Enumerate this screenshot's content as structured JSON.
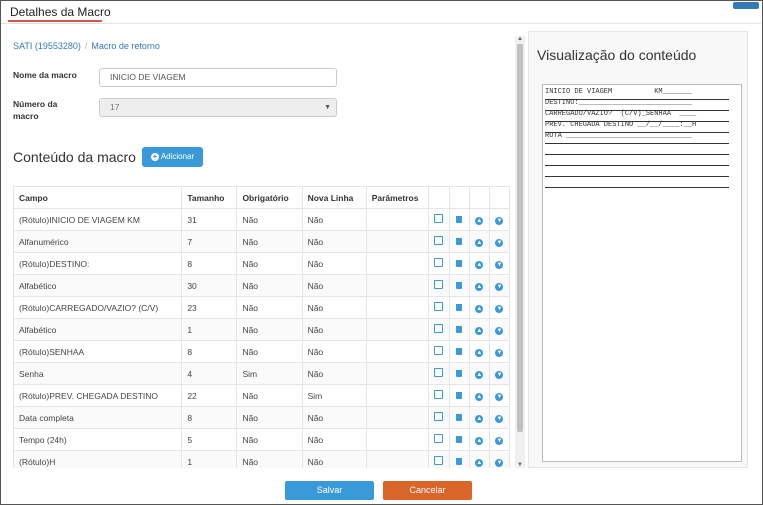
{
  "window": {
    "title": "Detalhes da Macro"
  },
  "breadcrumb": {
    "item1": "SATI (19553280)",
    "sep": "/",
    "item2": "Macro de retorno"
  },
  "form": {
    "nome_label": "Nome da macro",
    "nome_value": "INICIO DE VIAGEM",
    "numero_label_1": "Número da",
    "numero_label_2": "macro",
    "numero_value": "17"
  },
  "content": {
    "title": "Conteúdo da macro",
    "add_label": "Adicionar"
  },
  "table": {
    "headers": [
      "Campo",
      "Tamanho",
      "Obrigatório",
      "Nova Linha",
      "Parâmetros"
    ],
    "rows": [
      [
        "(Rótulo)INICIO DE VIAGEM KM",
        "31",
        "Não",
        "Não"
      ],
      [
        "Alfanumérico",
        "7",
        "Não",
        "Não"
      ],
      [
        "(Rótulo)DESTINO:",
        "8",
        "Não",
        "Não"
      ],
      [
        "Alfabético",
        "30",
        "Não",
        "Não"
      ],
      [
        "(Rótulo)CARREGADO/VAZIO? (C/V)",
        "23",
        "Não",
        "Não"
      ],
      [
        "Alfabético",
        "1",
        "Não",
        "Não"
      ],
      [
        "(Rótulo)SENHAA",
        "8",
        "Não",
        "Não"
      ],
      [
        "Senha",
        "4",
        "Sim",
        "Não"
      ],
      [
        "(Rótulo)PREV. CHEGADA DESTINO",
        "22",
        "Não",
        "Sim"
      ],
      [
        "Data completa",
        "8",
        "Não",
        "Não"
      ],
      [
        "Tempo (24h)",
        "5",
        "Não",
        "Não"
      ],
      [
        "(Rótulo)H",
        "1",
        "Não",
        "Não"
      ]
    ]
  },
  "preview": {
    "title": "Visualização do conteúdo",
    "lines": [
      "INICIO DE VIAGEM          KM_______",
      "DESTINO:___________________________",
      "CARREGADO/VAZIO?  (C/V)_SENHAA  ____",
      "PREV. CHEGADA DESTINO __/__/____:__H",
      "ROTA ______________________________",
      "",
      "",
      "",
      ""
    ]
  },
  "footer": {
    "save_label": "Salvar",
    "cancel_label": "Cancelar"
  },
  "colors": {
    "primary": "#3a9ad9",
    "danger": "#d9652b",
    "title_underline": "#d9534f"
  }
}
